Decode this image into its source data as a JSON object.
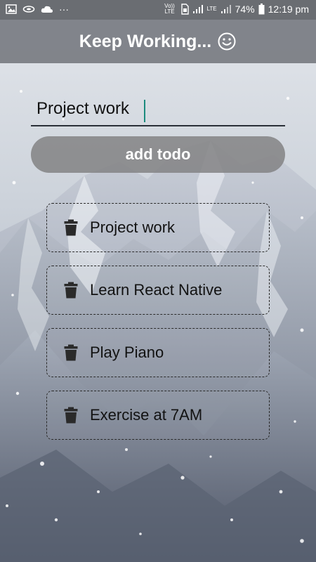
{
  "status_bar": {
    "battery": "74%",
    "time": "12:19 pm",
    "volte": "Vo)) LTE",
    "lte": "LTE",
    "dots": "···"
  },
  "header": {
    "title": "Keep Working...",
    "icon": "smiley-icon"
  },
  "input": {
    "value": "Project work",
    "placeholder": ""
  },
  "add_button": {
    "label": "add todo"
  },
  "todos": [
    {
      "text": "Project work",
      "icon": "trash-icon"
    },
    {
      "text": "Learn React Native",
      "icon": "trash-icon"
    },
    {
      "text": "Play Piano",
      "icon": "trash-icon"
    },
    {
      "text": "Exercise at 7AM",
      "icon": "trash-icon"
    }
  ],
  "colors": {
    "header_bg": "#787c82",
    "button_bg": "#828284",
    "caret": "#1c8b7e"
  }
}
